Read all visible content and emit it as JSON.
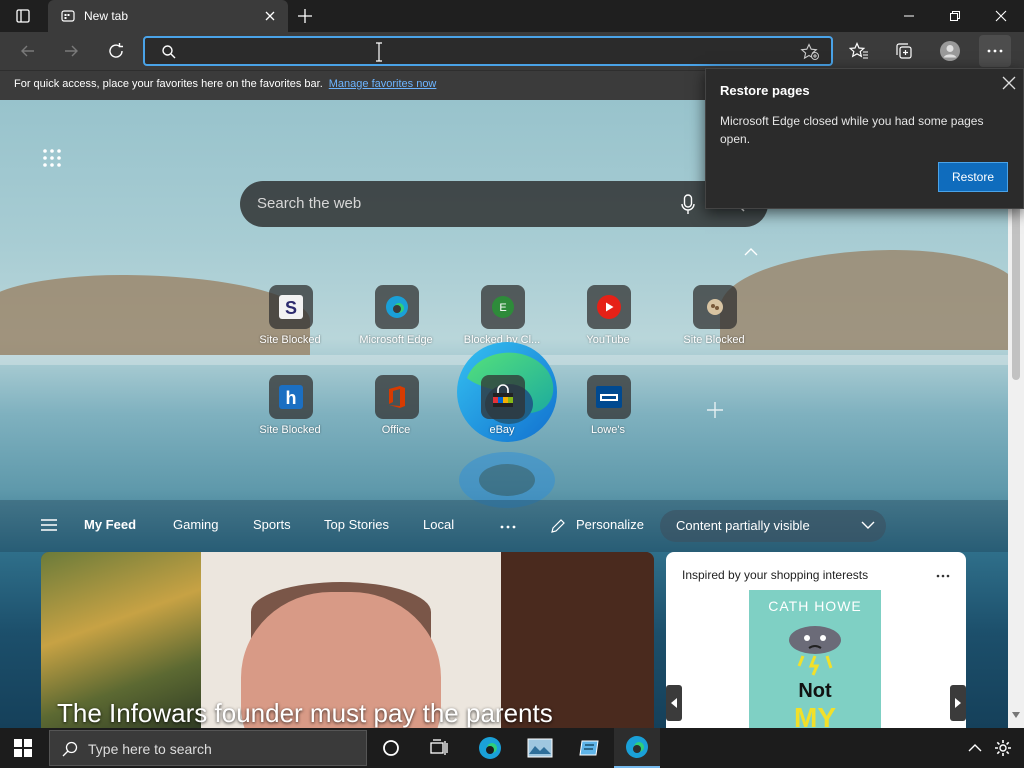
{
  "tab": {
    "title": "New tab"
  },
  "favorites_bar": {
    "message": "For quick access, place your favorites here on the favorites bar.",
    "link": "Manage favorites now"
  },
  "search": {
    "placeholder": "Search the web"
  },
  "tiles": [
    {
      "label": "Site Blocked",
      "icon": "s-letter-icon",
      "color": "#3e3a8e"
    },
    {
      "label": "Microsoft Edge",
      "icon": "edge-icon",
      "color": "#1aa0d8"
    },
    {
      "label": "Blocked by Cl...",
      "icon": "e-circle-icon",
      "color": "#2e8b3a"
    },
    {
      "label": "YouTube",
      "icon": "youtube-icon",
      "color": "#e62117"
    },
    {
      "label": "Site Blocked",
      "icon": "blocked-icon",
      "color": "#c0a070"
    },
    {
      "label": "Site Blocked",
      "icon": "h-letter-icon",
      "color": "#1b6fc2"
    },
    {
      "label": "Office",
      "icon": "office-icon",
      "color": "#d83b01"
    },
    {
      "label": "eBay",
      "icon": "ebay-bag-icon",
      "color": "#2c2c2c"
    },
    {
      "label": "Lowe's",
      "icon": "lowes-icon",
      "color": "#004990"
    }
  ],
  "feed": {
    "tabs": [
      "My Feed",
      "Gaming",
      "Sports",
      "Top Stories",
      "Local"
    ],
    "personalize": "Personalize",
    "content_visibility": "Content partially visible"
  },
  "hero": {
    "headline": "The Infowars founder must pay the parents"
  },
  "shopping": {
    "heading": "Inspired by your shopping interests",
    "book_author": "CATH HOWE",
    "book_title_1": "Not",
    "book_title_2": "MY"
  },
  "popup": {
    "title": "Restore pages",
    "message": "Microsoft Edge closed while you had some pages open.",
    "button": "Restore"
  },
  "taskbar": {
    "search_placeholder": "Type here to search"
  }
}
